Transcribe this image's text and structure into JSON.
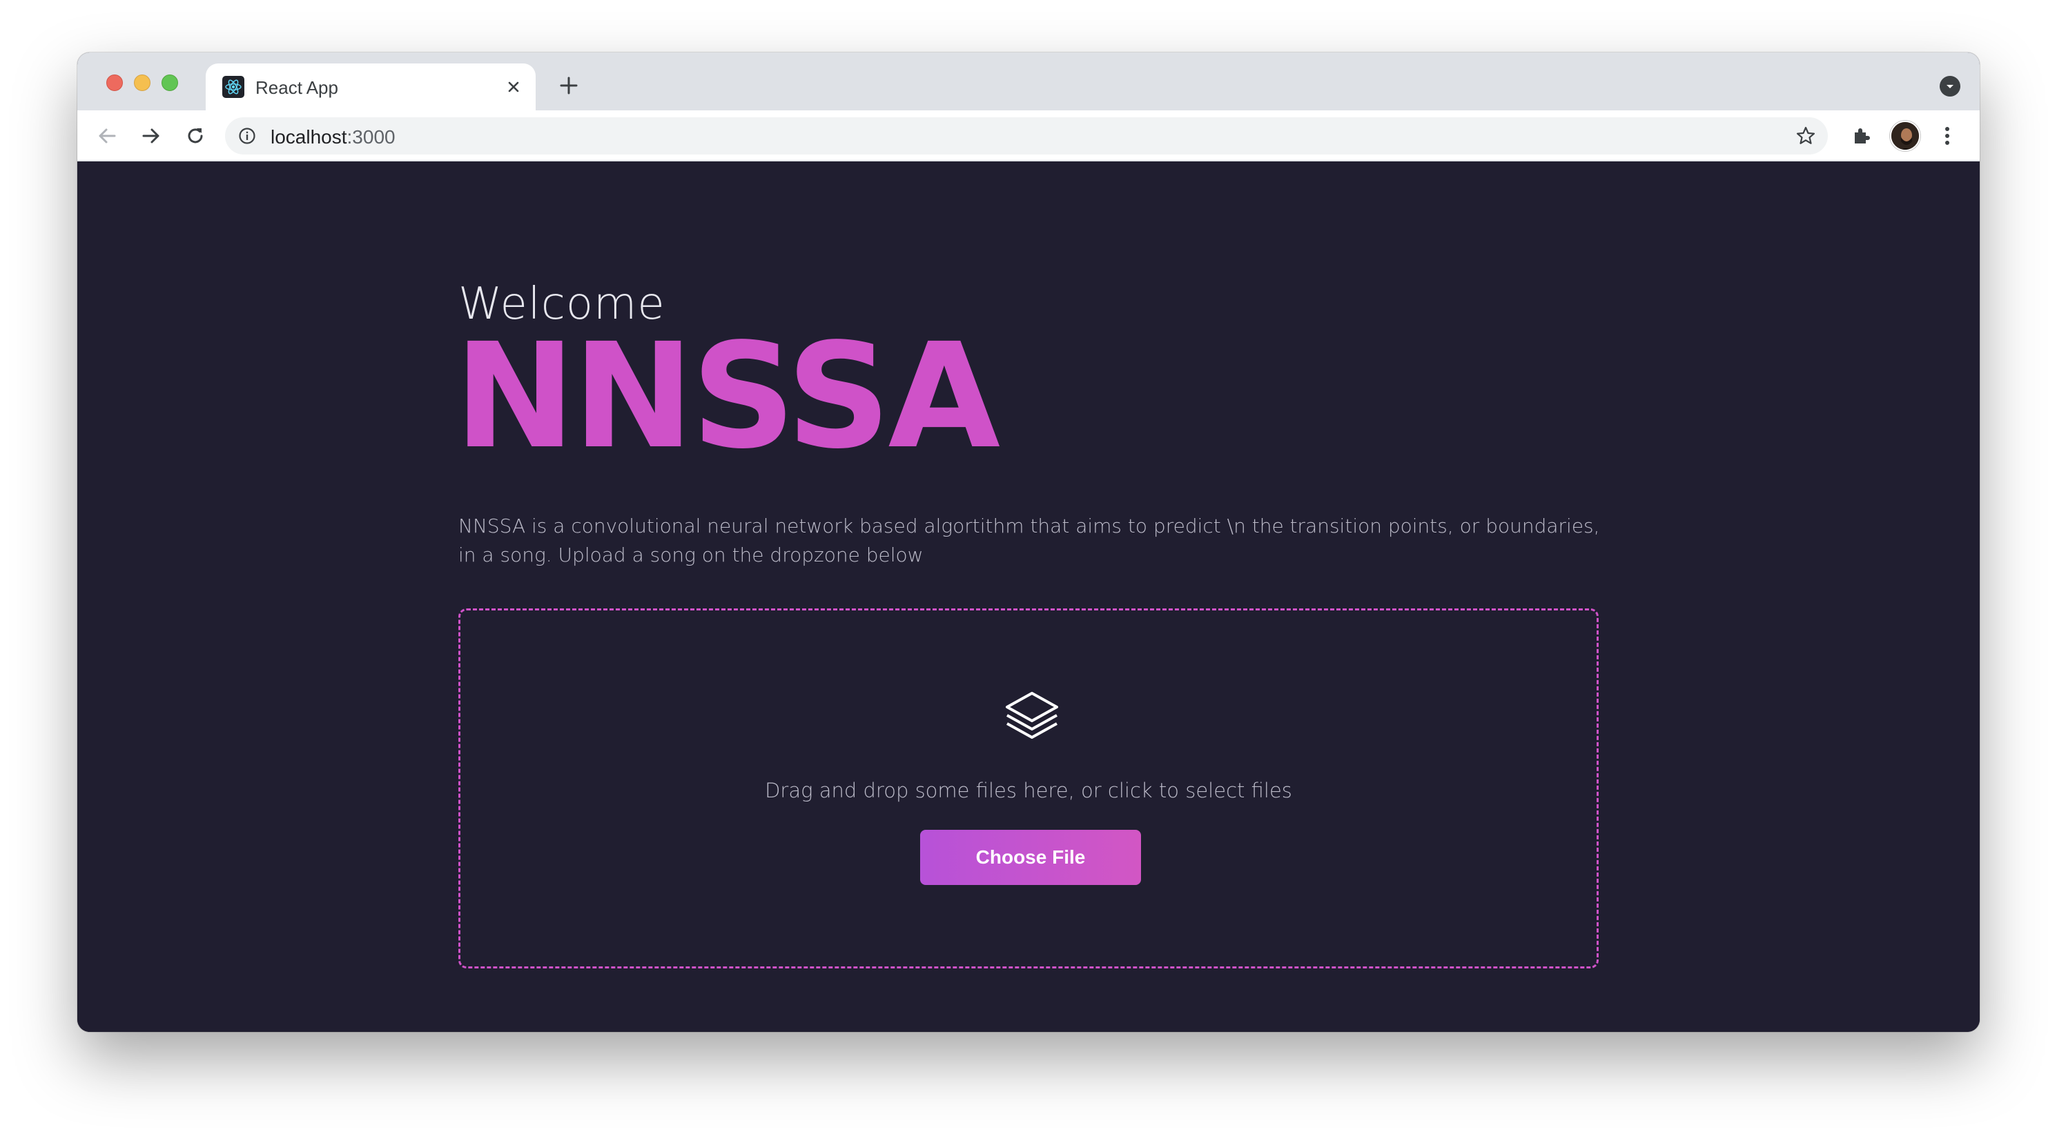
{
  "browser": {
    "tab_title": "React App",
    "url_host": "localhost",
    "url_port": ":3000"
  },
  "page": {
    "welcome": "Welcome",
    "brand": "NNSSA",
    "description": "NNSSA is a convolutional neural network based algortithm that aims to predict \\n the transition points, or boundaries, in a song. Upload a song on the dropzone below",
    "dropzone": {
      "icon": "layers-icon",
      "prompt": "Drag and drop some files here, or click to select files",
      "button_label": "Choose File"
    }
  },
  "colors": {
    "page_background": "#201e30",
    "accent": "#cf52c8",
    "button_gradient_start": "#b752d8",
    "button_gradient_end": "#d256c4"
  }
}
